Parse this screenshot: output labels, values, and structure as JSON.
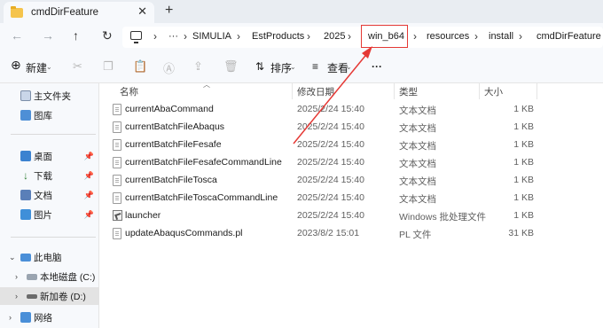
{
  "tab": {
    "title": "cmdDirFeature",
    "close": "✕",
    "new_tab": "+"
  },
  "nav": {
    "back": "←",
    "forward": "→",
    "up": "↑",
    "refresh": "↻"
  },
  "address": {
    "more": "···",
    "crumbs": [
      "SIMULIA",
      "EstProducts",
      "2025",
      "win_b64",
      "resources",
      "install",
      "cmdDirFeature"
    ],
    "separator": "›"
  },
  "toolbar": {
    "new_label": "新建",
    "sort_label": "排序",
    "view_label": "查看",
    "more": "···"
  },
  "sidebar": {
    "home": "主文件夹",
    "gallery": "图库",
    "desktop": "桌面",
    "downloads": "下载",
    "documents": "文档",
    "pictures": "图片",
    "this_pc": "此电脑",
    "local_c": "本地磁盘 (C:)",
    "new_d": "新加卷 (D:)",
    "network": "网络"
  },
  "columns": {
    "name": "名称",
    "date": "修改日期",
    "type": "类型",
    "size": "大小"
  },
  "files": [
    {
      "name": "currentAbaCommand",
      "date": "2025/2/24 15:40",
      "type": "文本文档",
      "size": "1 KB",
      "icon": "text-file-icon"
    },
    {
      "name": "currentBatchFileAbaqus",
      "date": "2025/2/24 15:40",
      "type": "文本文档",
      "size": "1 KB",
      "icon": "text-file-icon"
    },
    {
      "name": "currentBatchFileFesafe",
      "date": "2025/2/24 15:40",
      "type": "文本文档",
      "size": "1 KB",
      "icon": "text-file-icon"
    },
    {
      "name": "currentBatchFileFesafeCommandLine",
      "date": "2025/2/24 15:40",
      "type": "文本文档",
      "size": "1 KB",
      "icon": "text-file-icon"
    },
    {
      "name": "currentBatchFileTosca",
      "date": "2025/2/24 15:40",
      "type": "文本文档",
      "size": "1 KB",
      "icon": "text-file-icon"
    },
    {
      "name": "currentBatchFileToscaCommandLine",
      "date": "2025/2/24 15:40",
      "type": "文本文档",
      "size": "1 KB",
      "icon": "text-file-icon"
    },
    {
      "name": "launcher",
      "date": "2025/2/24 15:40",
      "type": "Windows 批处理文件",
      "size": "1 KB",
      "icon": "batch-file-icon"
    },
    {
      "name": "updateAbaqusCommands.pl",
      "date": "2023/8/2 15:01",
      "type": "PL 文件",
      "size": "31 KB",
      "icon": "text-file-icon"
    }
  ],
  "colors": {
    "highlight": "#e53935",
    "folder": "#f5c44c",
    "selected": "#e3e3e3"
  }
}
